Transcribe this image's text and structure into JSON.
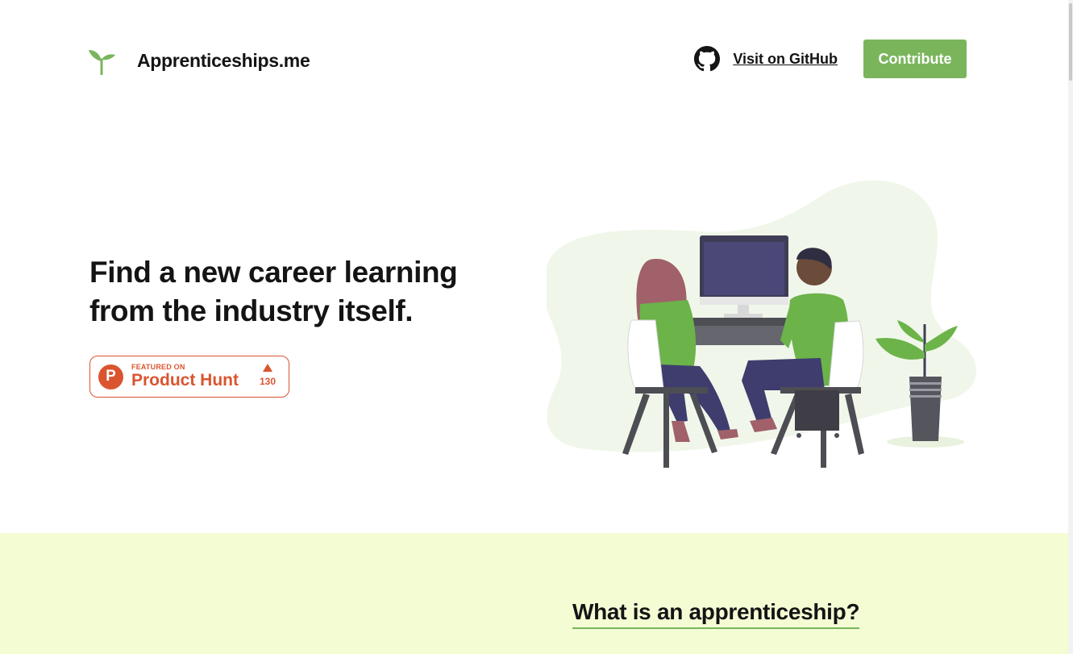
{
  "header": {
    "brand_name": "Apprenticeships.me",
    "logo_icon": "sprout-icon",
    "github_icon": "github-icon",
    "github_label": "Visit on GitHub",
    "contribute_label": "Contribute"
  },
  "hero": {
    "title": "Find a new career learning from the industry itself.",
    "illustration": "two-people-at-computer-illustration",
    "product_hunt": {
      "logo_letter": "P",
      "featured_label": "FEATURED ON",
      "name": "Product Hunt",
      "upvotes": "130"
    }
  },
  "section": {
    "title": "What is an apprenticeship?"
  },
  "colors": {
    "accent": "#7ab55c",
    "product_hunt": "#da552f",
    "section_background": "#f4fcd4",
    "text": "#141414"
  }
}
